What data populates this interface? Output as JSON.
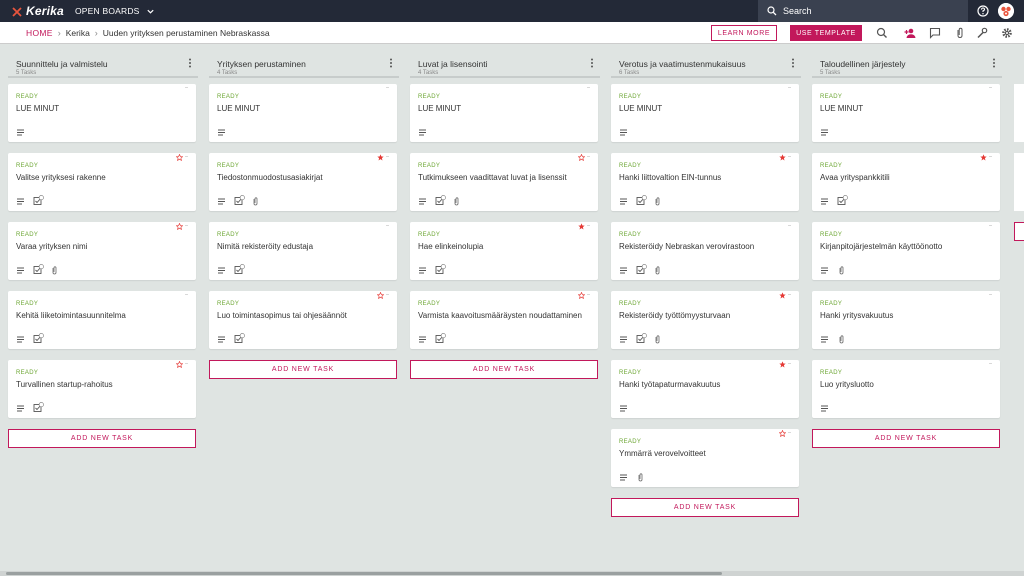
{
  "app": {
    "logo_text": "Kerika",
    "open_boards_label": "OPEN BOARDS",
    "search_placeholder": "Search"
  },
  "breadcrumb": {
    "home": "HOME",
    "org": "Kerika",
    "board": "Uuden yrityksen perustaminen Nebraskassa"
  },
  "buttons": {
    "learn_more": "LEARN MORE",
    "use_template": "USE TEMPLATE",
    "add_task": "ADD NEW TASK"
  },
  "colors": {
    "accent": "#c2185b",
    "ready": "#6ca633",
    "star": "#e53935",
    "topbar": "#232937"
  },
  "columns": [
    {
      "title": "Suunnittelu ja valmistelu",
      "count": "5 Tasks",
      "cards": [
        {
          "status": "READY",
          "title": "LUE MINUT",
          "star": "none",
          "icons": [
            "description"
          ]
        },
        {
          "status": "READY",
          "title": "Valitse yrityksesi rakenne",
          "star": "outline",
          "icons": [
            "description",
            "checklist"
          ]
        },
        {
          "status": "READY",
          "title": "Varaa yrityksen nimi",
          "star": "outline",
          "icons": [
            "description",
            "checklist",
            "attachment"
          ]
        },
        {
          "status": "READY",
          "title": "Kehitä liiketoimintasuunnitelma",
          "star": "none",
          "icons": [
            "description",
            "checklist"
          ]
        },
        {
          "status": "READY",
          "title": "Turvallinen startup-rahoitus",
          "star": "outline",
          "icons": [
            "description",
            "checklist"
          ]
        }
      ]
    },
    {
      "title": "Yrityksen perustaminen",
      "count": "4 Tasks",
      "cards": [
        {
          "status": "READY",
          "title": "LUE MINUT",
          "star": "none",
          "icons": [
            "description"
          ]
        },
        {
          "status": "READY",
          "title": "Tiedostonmuodostusasiakirjat",
          "star": "filled",
          "icons": [
            "description",
            "checklist",
            "attachment"
          ]
        },
        {
          "status": "READY",
          "title": "Nimitä rekisteröity edustaja",
          "star": "none",
          "icons": [
            "description",
            "checklist"
          ]
        },
        {
          "status": "READY",
          "title": "Luo toimintasopimus tai ohjesäännöt",
          "star": "outline",
          "icons": [
            "description",
            "checklist"
          ]
        }
      ]
    },
    {
      "title": "Luvat ja lisensointi",
      "count": "4 Tasks",
      "cards": [
        {
          "status": "READY",
          "title": "LUE MINUT",
          "star": "none",
          "icons": [
            "description"
          ]
        },
        {
          "status": "READY",
          "title": "Tutkimukseen vaadittavat luvat ja lisenssit",
          "star": "outline",
          "icons": [
            "description",
            "checklist",
            "attachment"
          ]
        },
        {
          "status": "READY",
          "title": "Hae elinkeinolupia",
          "star": "filled",
          "icons": [
            "description",
            "checklist"
          ]
        },
        {
          "status": "READY",
          "title": "Varmista kaavoitusmääräysten noudattaminen",
          "star": "outline",
          "icons": [
            "description",
            "checklist"
          ]
        }
      ]
    },
    {
      "title": "Verotus ja vaatimustenmukaisuus",
      "count": "6 Tasks",
      "cards": [
        {
          "status": "READY",
          "title": "LUE MINUT",
          "star": "none",
          "icons": [
            "description"
          ]
        },
        {
          "status": "READY",
          "title": "Hanki liittovaltion EIN-tunnus",
          "star": "filled",
          "icons": [
            "description",
            "checklist",
            "attachment"
          ]
        },
        {
          "status": "READY",
          "title": "Rekisteröidy Nebraskan verovirastoon",
          "star": "none",
          "icons": [
            "description",
            "checklist",
            "attachment"
          ]
        },
        {
          "status": "READY",
          "title": "Rekisteröidy työttömyysturvaan",
          "star": "filled",
          "icons": [
            "description",
            "checklist",
            "attachment"
          ]
        },
        {
          "status": "READY",
          "title": "Hanki työtapaturmavakuutus",
          "star": "filled",
          "icons": [
            "description"
          ]
        },
        {
          "status": "READY",
          "title": "Ymmärrä verovelvoitteet",
          "star": "outline",
          "icons": [
            "description",
            "attachment"
          ]
        }
      ]
    },
    {
      "title": "Taloudellinen järjestely",
      "count": "5 Tasks",
      "cards": [
        {
          "status": "READY",
          "title": "LUE MINUT",
          "star": "none",
          "icons": [
            "description"
          ]
        },
        {
          "status": "READY",
          "title": "Avaa yrityspankkitili",
          "star": "filled",
          "icons": [
            "description",
            "checklist"
          ]
        },
        {
          "status": "READY",
          "title": "Kirjanpitojärjestelmän käyttöönotto",
          "star": "none",
          "icons": [
            "description",
            "attachment"
          ]
        },
        {
          "status": "READY",
          "title": "Hanki yritysvakuutus",
          "star": "none",
          "icons": [
            "description",
            "attachment"
          ]
        },
        {
          "status": "READY",
          "title": "Luo yritysluotto",
          "star": "none",
          "icons": [
            "description"
          ]
        }
      ]
    }
  ]
}
